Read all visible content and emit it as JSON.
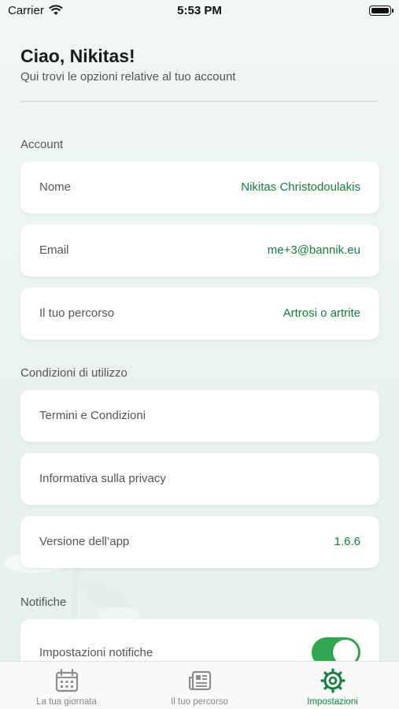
{
  "status_bar": {
    "carrier": "Carrier",
    "time": "5:53 PM"
  },
  "header": {
    "greeting": "Ciao, Nikitas!",
    "subtitle": "Qui trovi le opzioni relative al tuo account"
  },
  "account": {
    "title": "Account",
    "name_label": "Nome",
    "name_value": "Nikitas Christodoulakis",
    "email_label": "Email",
    "email_value": "me+3@bannik.eu",
    "path_label": "Il tuo percorso",
    "path_value": "Artrosi o artrite"
  },
  "terms": {
    "title": "Condizioni di utilizzo",
    "terms_label": "Termini e Condizioni",
    "privacy_label": "Informativa sulla privacy",
    "version_label": "Versione dell’app",
    "version_value": "1.6.6"
  },
  "notifications": {
    "title": "Notifiche",
    "settings_label": "Impostazioni notifiche",
    "enabled": true
  },
  "tabs": [
    {
      "label": "La tua giornata",
      "icon": "calendar-icon"
    },
    {
      "label": "Il tuo percorso",
      "icon": "newspaper-icon"
    },
    {
      "label": "Impostazioni",
      "icon": "gear-icon"
    }
  ],
  "colors": {
    "accent": "#15803d",
    "toggle_on": "#2fa84f",
    "background": "#eef5f1"
  }
}
